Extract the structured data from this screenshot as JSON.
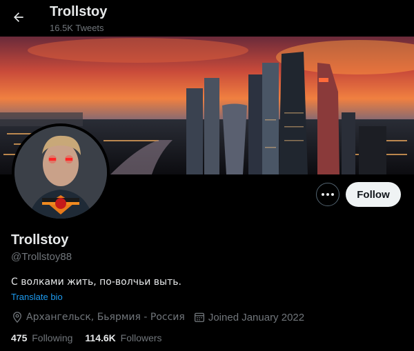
{
  "header": {
    "title": "Trollstoy",
    "tweet_count": "16.5K Tweets"
  },
  "profile": {
    "display_name": "Trollstoy",
    "handle": "@Trollstoy88",
    "bio": "С волками жить, по-волчьи выть.",
    "translate_label": "Translate bio",
    "location": "Архангельск, Бьярмия - Россия",
    "joined": "Joined January 2022",
    "following_count": "475",
    "following_label": "Following",
    "followers_count": "114.6K",
    "followers_label": "Followers"
  },
  "actions": {
    "follow_label": "Follow"
  },
  "colors": {
    "background": "#000000",
    "link": "#1d9bf0",
    "secondary_text": "#71767b",
    "follow_button_bg": "#eff3f4"
  },
  "icons": [
    "back-arrow-icon",
    "more-icon",
    "location-icon",
    "calendar-icon"
  ]
}
